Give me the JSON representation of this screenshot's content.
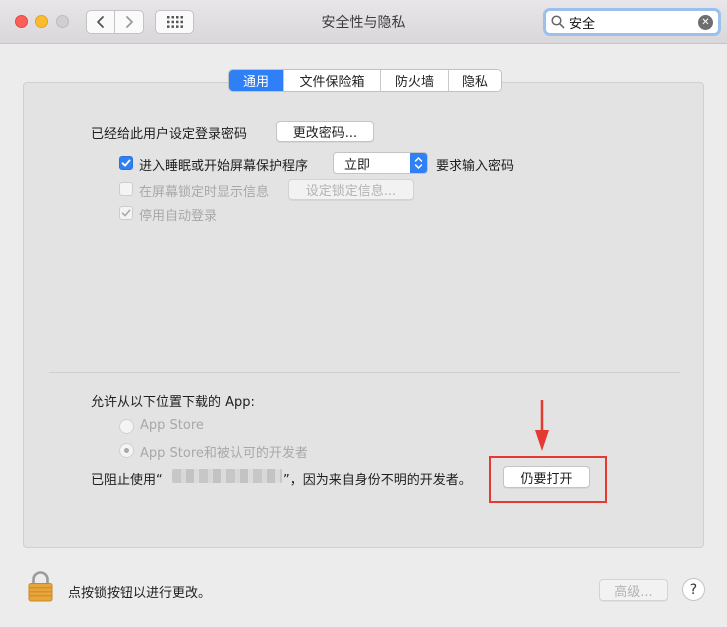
{
  "window": {
    "title": "安全性与隐私"
  },
  "toolbar": {
    "search_value": "安全"
  },
  "tabs": [
    {
      "label": "通用",
      "active": true
    },
    {
      "label": "文件保险箱",
      "active": false
    },
    {
      "label": "防火墙",
      "active": false
    },
    {
      "label": "隐私",
      "active": false
    }
  ],
  "general": {
    "password_set_label": "已经给此用户设定登录密码",
    "change_password_button": "更改密码...",
    "require_password_label": "进入睡眠或开始屏幕保护程序",
    "require_password_checked": true,
    "require_password_delay": "立即",
    "require_password_suffix": "要求输入密码",
    "lock_message_label": "在屏幕锁定时显示信息",
    "lock_message_checked": false,
    "set_lock_message_button": "设定锁定信息...",
    "disable_auto_login_label": "停用自动登录",
    "disable_auto_login_checked": true
  },
  "download": {
    "heading": "允许从以下位置下载的 App:",
    "option_app_store": "App Store",
    "option_identified": "App Store和被认可的开发者",
    "selected": "App Store和被认可的开发者",
    "blocked_prefix": "已阻止使用“",
    "blocked_suffix": "”，因为来自身份不明的开发者。",
    "open_anyway_button": "仍要打开"
  },
  "footer": {
    "lock_text": "点按锁按钮以进行更改。",
    "advanced_button": "高级...",
    "help_label": "?"
  },
  "colors": {
    "accent": "#2f7ff6",
    "annotation_red": "#e33a32"
  }
}
